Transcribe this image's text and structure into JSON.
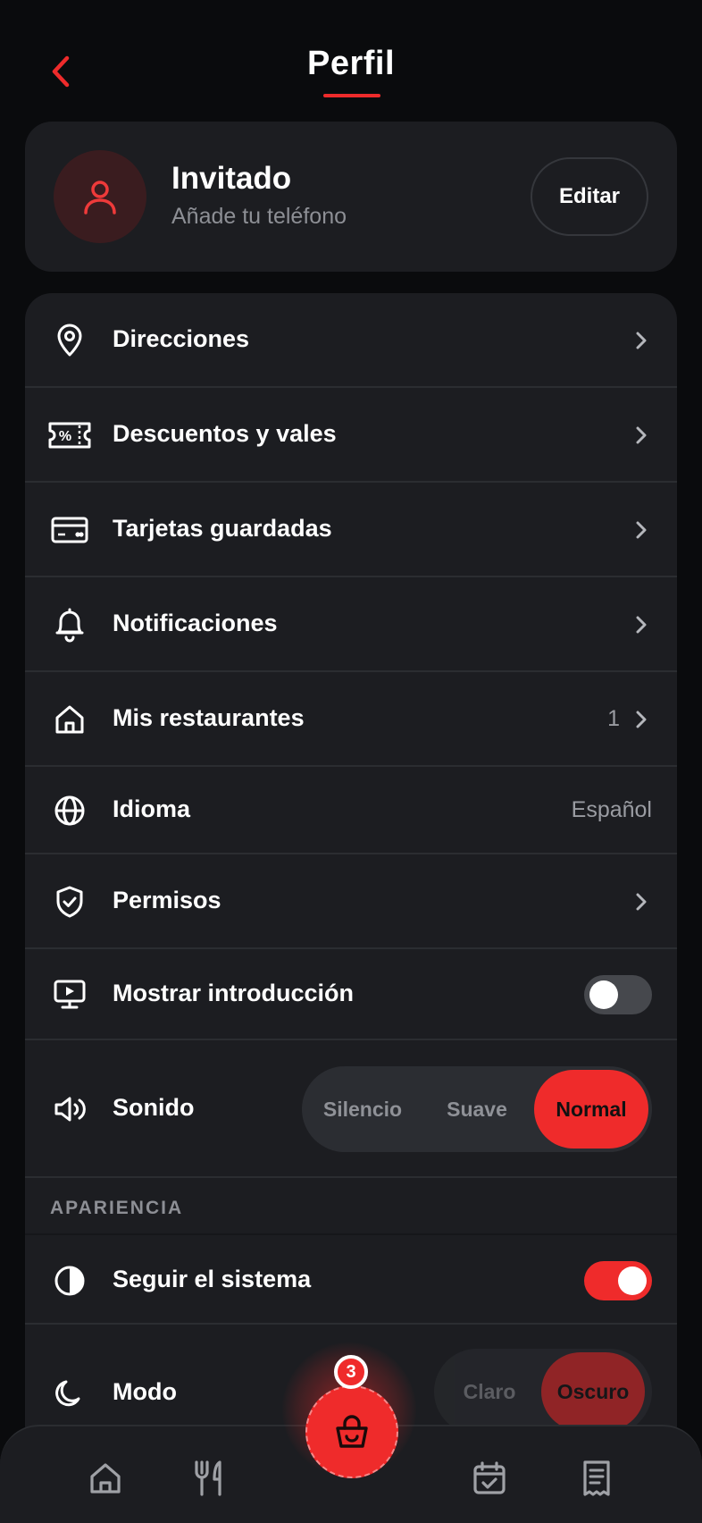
{
  "header": {
    "title": "Perfil"
  },
  "profile": {
    "name": "Invitado",
    "subtitle": "Añade tu teléfono",
    "edit_label": "Editar"
  },
  "settings": {
    "addresses": {
      "label": "Direcciones"
    },
    "discounts": {
      "label": "Descuentos y vales"
    },
    "cards": {
      "label": "Tarjetas guardadas"
    },
    "notifications": {
      "label": "Notificaciones"
    },
    "restaurants": {
      "label": "Mis restaurantes",
      "count": "1"
    },
    "language": {
      "label": "Idioma",
      "value": "Español"
    },
    "permissions": {
      "label": "Permisos"
    },
    "intro": {
      "label": "Mostrar introducción",
      "enabled": false
    },
    "sound": {
      "label": "Sonido",
      "options": [
        "Silencio",
        "Suave",
        "Normal"
      ],
      "selected": "Normal"
    }
  },
  "appearance": {
    "section_label": "APARIENCIA",
    "follow_system": {
      "label": "Seguir el sistema",
      "enabled": true
    },
    "mode": {
      "label": "Modo",
      "options": [
        "Claro",
        "Oscuro"
      ],
      "selected": "Oscuro"
    }
  },
  "cart": {
    "badge_count": "3"
  },
  "colors": {
    "accent": "#ef2b2b",
    "background": "#0a0b0d",
    "card": "#1c1d21"
  },
  "nav": {
    "items": [
      "home-icon",
      "utensils-icon",
      "basket-icon",
      "calendar-check-icon",
      "receipt-icon"
    ]
  }
}
